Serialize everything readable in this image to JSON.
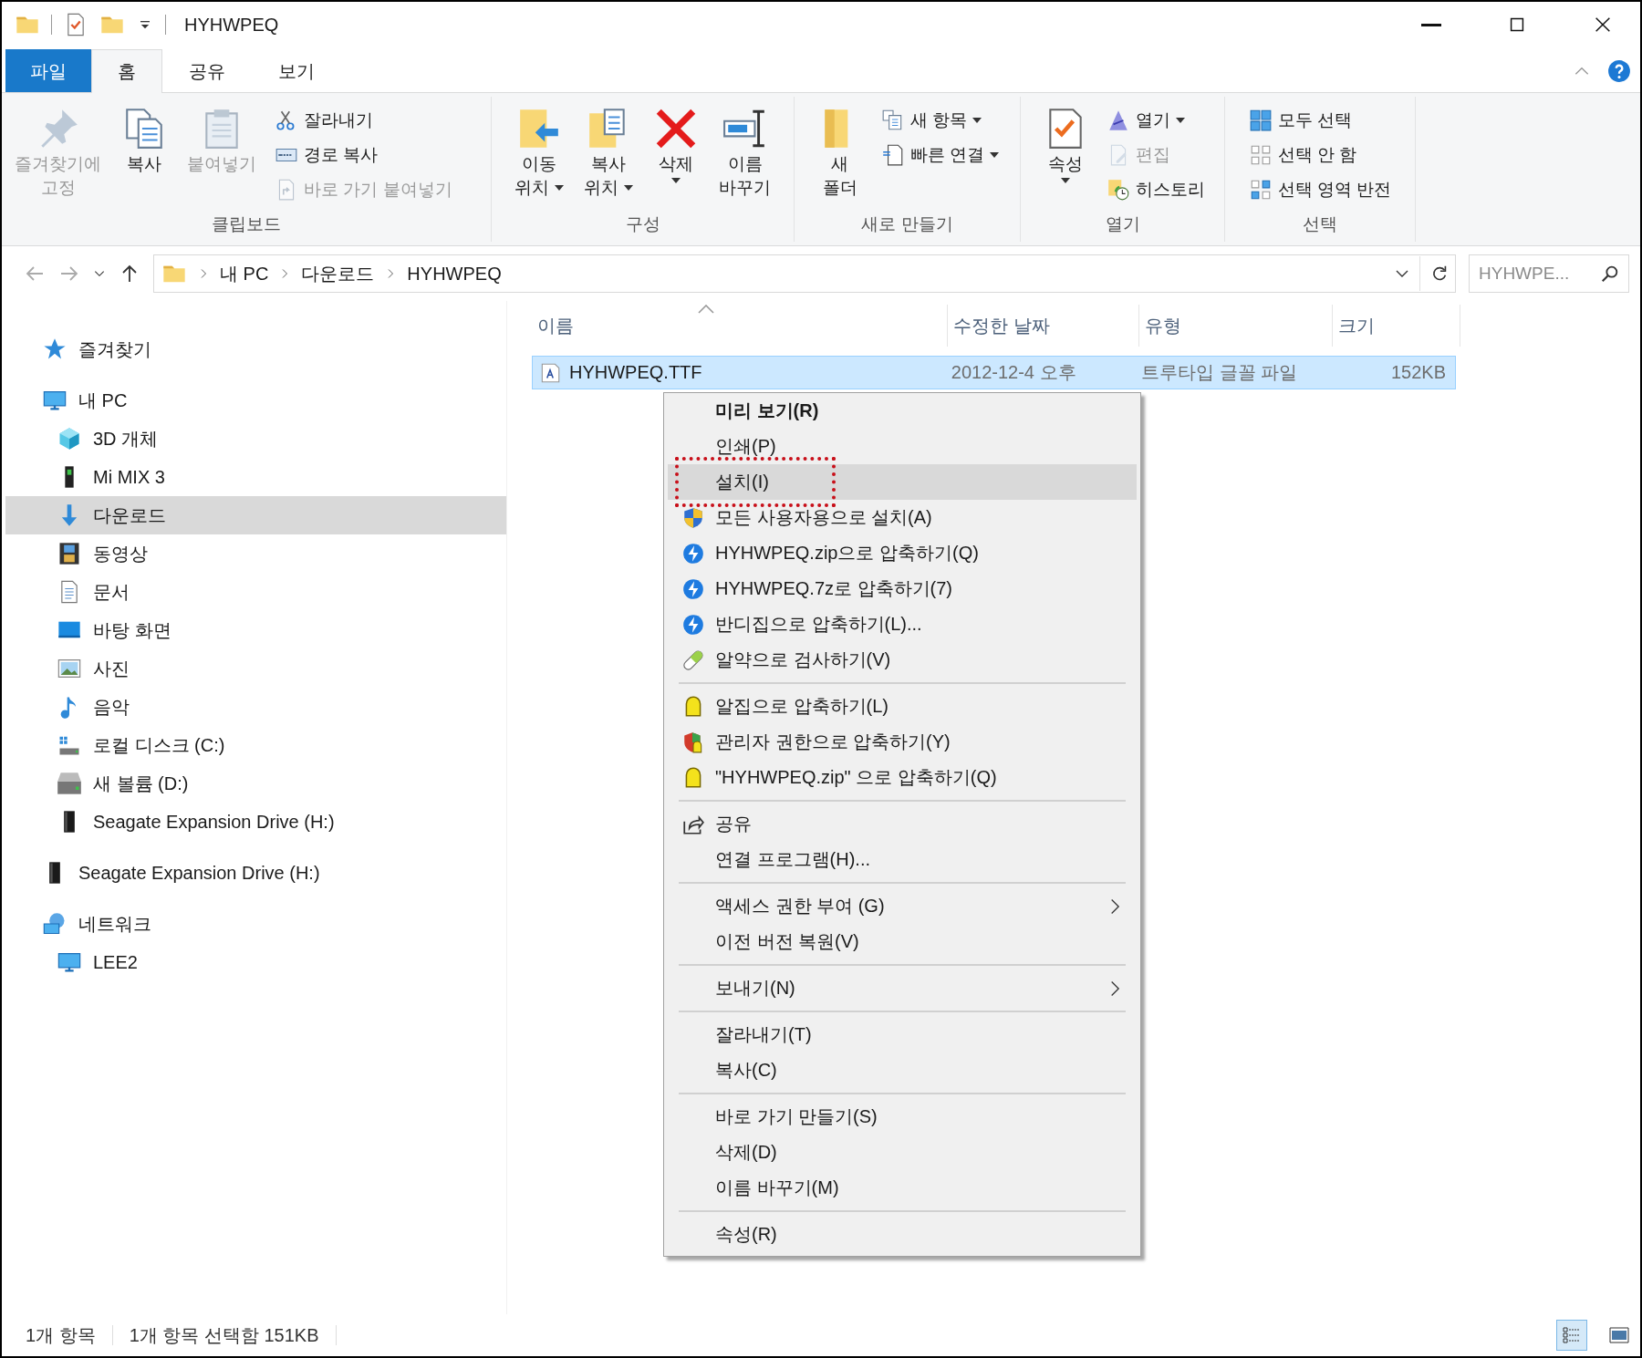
{
  "window": {
    "title": "HYHWPEQ"
  },
  "ribbon_tabs": [
    {
      "label": "파일",
      "kind": "file",
      "selected": false
    },
    {
      "label": "홈",
      "kind": "tab",
      "selected": true
    },
    {
      "label": "공유",
      "kind": "tab",
      "selected": false
    },
    {
      "label": "보기",
      "kind": "tab",
      "selected": false
    }
  ],
  "ribbon_groups": [
    {
      "label": "클립보드",
      "columns": [
        {
          "kind": "large",
          "lines": [
            "즐겨찾기에",
            "고정"
          ],
          "disabled": true,
          "dropdown": false
        },
        {
          "kind": "large",
          "lines": [
            "복사"
          ],
          "disabled": false,
          "dropdown": false
        },
        {
          "kind": "large",
          "lines": [
            "붙여넣기"
          ],
          "disabled": true,
          "dropdown": false
        },
        {
          "kind": "stack",
          "items": [
            {
              "label": "잘라내기",
              "disabled": false,
              "dropdown": false
            },
            {
              "label": "경로 복사",
              "disabled": false,
              "dropdown": false
            },
            {
              "label": "바로 가기 붙여넣기",
              "disabled": true,
              "dropdown": false
            }
          ]
        }
      ]
    },
    {
      "label": "구성",
      "columns": [
        {
          "kind": "large",
          "lines": [
            "이동",
            "위치"
          ],
          "disabled": false,
          "dropdown": true
        },
        {
          "kind": "large",
          "lines": [
            "복사",
            "위치"
          ],
          "disabled": false,
          "dropdown": true
        },
        {
          "kind": "large",
          "lines": [
            "삭제"
          ],
          "disabled": false,
          "dropdown": true
        },
        {
          "kind": "large",
          "lines": [
            "이름",
            "바꾸기"
          ],
          "disabled": false,
          "dropdown": false
        }
      ]
    },
    {
      "label": "새로 만들기",
      "columns": [
        {
          "kind": "large",
          "lines": [
            "새",
            "폴더"
          ],
          "disabled": false,
          "dropdown": false
        },
        {
          "kind": "stack",
          "items": [
            {
              "label": "새 항목",
              "disabled": false,
              "dropdown": true
            },
            {
              "label": "빠른 연결",
              "disabled": false,
              "dropdown": true
            }
          ]
        }
      ]
    },
    {
      "label": "열기",
      "columns": [
        {
          "kind": "large",
          "lines": [
            "속성"
          ],
          "disabled": false,
          "dropdown": true
        },
        {
          "kind": "stack",
          "items": [
            {
              "label": "열기",
              "disabled": false,
              "dropdown": true
            },
            {
              "label": "편집",
              "disabled": true,
              "dropdown": false
            },
            {
              "label": "히스토리",
              "disabled": false,
              "dropdown": false
            }
          ]
        }
      ]
    },
    {
      "label": "선택",
      "columns": [
        {
          "kind": "stack",
          "items": [
            {
              "label": "모두 선택",
              "disabled": false,
              "dropdown": false
            },
            {
              "label": "선택 안 함",
              "disabled": false,
              "dropdown": false
            },
            {
              "label": "선택 영역 반전",
              "disabled": false,
              "dropdown": false
            }
          ]
        }
      ]
    }
  ],
  "address": {
    "crumbs": [
      "내 PC",
      "다운로드",
      "HYHWPEQ"
    ],
    "search_placeholder": "HYHWPE..."
  },
  "sidebar": {
    "items": [
      {
        "label": "즐겨찾기",
        "selected": false
      },
      {
        "label": "내 PC",
        "selected": false,
        "children": [
          {
            "label": "3D 개체",
            "selected": false
          },
          {
            "label": "Mi MIX 3",
            "selected": false
          },
          {
            "label": "다운로드",
            "selected": true
          },
          {
            "label": "동영상",
            "selected": false
          },
          {
            "label": "문서",
            "selected": false
          },
          {
            "label": "바탕 화면",
            "selected": false
          },
          {
            "label": "사진",
            "selected": false
          },
          {
            "label": "음악",
            "selected": false
          },
          {
            "label": "로컬 디스크 (C:)",
            "selected": false
          },
          {
            "label": "새 볼륨 (D:)",
            "selected": false
          },
          {
            "label": "Seagate Expansion Drive (H:)",
            "selected": false
          }
        ]
      },
      {
        "label": "Seagate Expansion Drive (H:)",
        "selected": false
      },
      {
        "label": "네트워크",
        "selected": false,
        "children": [
          {
            "label": "LEE2",
            "selected": false
          }
        ]
      }
    ]
  },
  "table": {
    "columns": [
      {
        "label": "이름",
        "sorted": true
      },
      {
        "label": "수정한 날짜",
        "sorted": false
      },
      {
        "label": "유형",
        "sorted": false
      },
      {
        "label": "크기",
        "sorted": false
      }
    ],
    "rows": [
      {
        "cells": [
          "HYHWPEQ.TTF",
          "2012-12-4 오후",
          "트루타입 글꼴 파일",
          "152KB"
        ],
        "selected": true
      }
    ]
  },
  "context_menu": {
    "groups": [
      [
        {
          "label": "미리 보기(R)",
          "default": true,
          "selected": false,
          "submenu": false,
          "annotated": false
        },
        {
          "label": "인쇄(P)",
          "default": false,
          "selected": false,
          "submenu": false,
          "annotated": false
        },
        {
          "label": "설치(I)",
          "default": false,
          "selected": true,
          "submenu": false,
          "annotated": true
        },
        {
          "label": "모든 사용자용으로 설치(A)",
          "default": false,
          "selected": false,
          "submenu": false,
          "annotated": false
        },
        {
          "label": "HYHWPEQ.zip으로 압축하기(Q)",
          "default": false,
          "selected": false,
          "submenu": false,
          "annotated": false
        },
        {
          "label": "HYHWPEQ.7z로 압축하기(7)",
          "default": false,
          "selected": false,
          "submenu": false,
          "annotated": false
        },
        {
          "label": "반디집으로 압축하기(L)...",
          "default": false,
          "selected": false,
          "submenu": false,
          "annotated": false
        },
        {
          "label": "알약으로 검사하기(V)",
          "default": false,
          "selected": false,
          "submenu": false,
          "annotated": false
        }
      ],
      [
        {
          "label": "알집으로 압축하기(L)",
          "default": false,
          "selected": false,
          "submenu": false,
          "annotated": false
        },
        {
          "label": "관리자 권한으로 압축하기(Y)",
          "default": false,
          "selected": false,
          "submenu": false,
          "annotated": false
        },
        {
          "label": "\"HYHWPEQ.zip\" 으로 압축하기(Q)",
          "default": false,
          "selected": false,
          "submenu": false,
          "annotated": false
        }
      ],
      [
        {
          "label": "공유",
          "default": false,
          "selected": false,
          "submenu": false,
          "annotated": false
        },
        {
          "label": "연결 프로그램(H)...",
          "default": false,
          "selected": false,
          "submenu": false,
          "annotated": false
        }
      ],
      [
        {
          "label": "액세스 권한 부여 (G)",
          "default": false,
          "selected": false,
          "submenu": true,
          "annotated": false
        },
        {
          "label": "이전 버전 복원(V)",
          "default": false,
          "selected": false,
          "submenu": false,
          "annotated": false
        }
      ],
      [
        {
          "label": "보내기(N)",
          "default": false,
          "selected": false,
          "submenu": true,
          "annotated": false
        }
      ],
      [
        {
          "label": "잘라내기(T)",
          "default": false,
          "selected": false,
          "submenu": false,
          "annotated": false
        },
        {
          "label": "복사(C)",
          "default": false,
          "selected": false,
          "submenu": false,
          "annotated": false
        }
      ],
      [
        {
          "label": "바로 가기 만들기(S)",
          "default": false,
          "selected": false,
          "submenu": false,
          "annotated": false
        },
        {
          "label": "삭제(D)",
          "default": false,
          "selected": false,
          "submenu": false,
          "annotated": false
        },
        {
          "label": "이름 바꾸기(M)",
          "default": false,
          "selected": false,
          "submenu": false,
          "annotated": false
        }
      ],
      [
        {
          "label": "속성(R)",
          "default": false,
          "selected": false,
          "submenu": false,
          "annotated": false
        }
      ]
    ]
  },
  "status_bar": {
    "texts": [
      "1개 항목",
      "1개 항목 선택함 151KB"
    ],
    "view_buttons": [
      {
        "selected": true
      },
      {
        "selected": false
      }
    ]
  }
}
